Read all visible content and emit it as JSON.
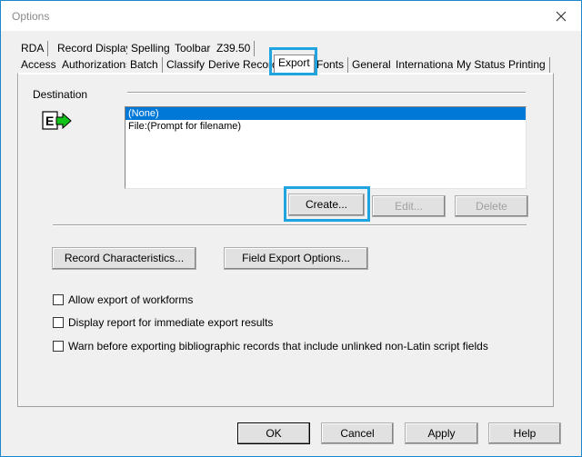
{
  "window": {
    "title": "Options",
    "accent_color": "#1ea4df"
  },
  "tabs": {
    "row1": [
      {
        "label": "RDA"
      },
      {
        "label": "Record Display"
      },
      {
        "label": "Spelling"
      },
      {
        "label": "Toolbar"
      },
      {
        "label": "Z39.50"
      }
    ],
    "row2": [
      {
        "label": "Access"
      },
      {
        "label": "Authorizations"
      },
      {
        "label": "Batch"
      },
      {
        "label": "Classify"
      },
      {
        "label": "Derive Record"
      },
      {
        "label": "Export",
        "active": true
      },
      {
        "label": "Fonts"
      },
      {
        "label": "General"
      },
      {
        "label": "International"
      },
      {
        "label": "My Status"
      },
      {
        "label": "Printing"
      }
    ]
  },
  "destination": {
    "label": "Destination",
    "icon_letter": "E",
    "items": [
      "(None)",
      "File:(Prompt for filename)"
    ],
    "selected_index": 0,
    "create_label": "Create...",
    "edit_label": "Edit...",
    "delete_label": "Delete"
  },
  "buttons": {
    "record_characteristics": "Record Characteristics...",
    "field_export_options": "Field Export Options..."
  },
  "checkboxes": [
    {
      "label": "Allow export of workforms",
      "checked": false
    },
    {
      "label": "Display report for immediate export results",
      "checked": false
    },
    {
      "label": "Warn before exporting bibliographic records that include unlinked non-Latin script fields",
      "checked": false
    }
  ],
  "footer": {
    "ok": "OK",
    "cancel": "Cancel",
    "apply": "Apply",
    "help": "Help"
  }
}
